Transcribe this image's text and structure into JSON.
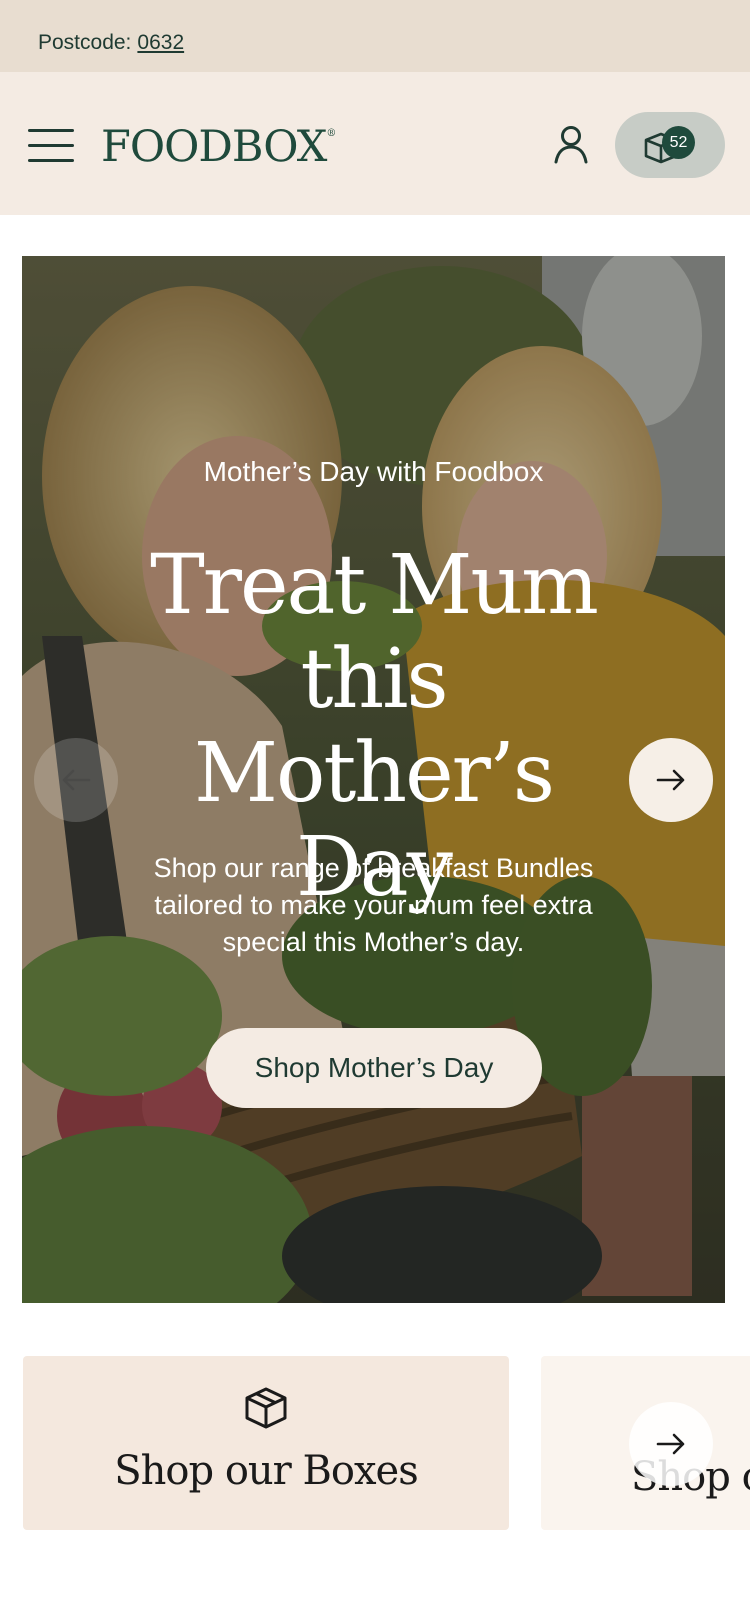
{
  "topbar": {
    "postcode_label": "Postcode:",
    "postcode_value": "0632"
  },
  "header": {
    "logo": "FOODBOX",
    "logo_mark": "®",
    "menu_icon": "hamburger-menu-icon",
    "account_icon": "user-icon",
    "cart_icon": "box-icon",
    "cart_count": "52"
  },
  "hero": {
    "eyebrow": "Mother’s Day with Foodbox",
    "title": "Treat Mum this Mother’s Day",
    "description": "Shop our range of breakfast Bundles tailored to make your mum feel extra special this Mother’s day.",
    "cta": "Shop Mother’s Day",
    "prev_icon": "arrow-left-icon",
    "next_icon": "arrow-right-icon"
  },
  "categories": {
    "items": [
      {
        "label": "Shop our Boxes",
        "icon": "package-icon"
      },
      {
        "label": "Shop o"
      }
    ],
    "next_icon": "arrow-right-icon"
  },
  "colors": {
    "topbar_bg": "#e8ddd0",
    "header_bg": "#f4ebe3",
    "brand_green": "#1f4a3c",
    "cart_pill": "#c7ccc6",
    "card_bg": "#f4e8de"
  }
}
